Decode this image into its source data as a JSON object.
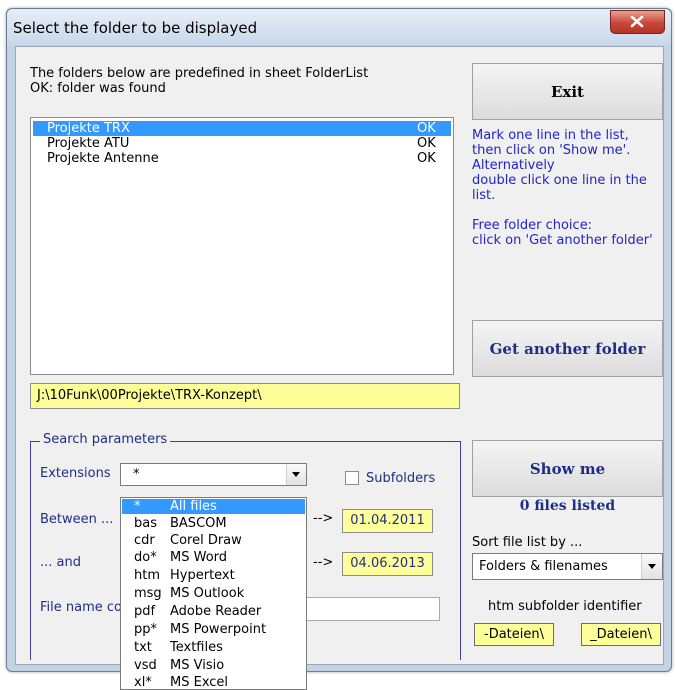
{
  "window": {
    "title": "Select the folder to be displayed",
    "close_icon": "close-icon"
  },
  "info": {
    "line1": "The folders below are predefined in sheet FolderList",
    "line2": "OK: folder was found"
  },
  "folders": [
    {
      "name": "Projekte TRX",
      "status": "OK",
      "selected": true
    },
    {
      "name": "Projekte ATU",
      "status": "OK",
      "selected": false
    },
    {
      "name": "Projekte Antenne",
      "status": "OK",
      "selected": false
    }
  ],
  "buttons": {
    "exit": "Exit",
    "get_another": "Get another folder",
    "show_me": "Show me"
  },
  "help": {
    "l1": "Mark one line in the list,",
    "l2": "then click on 'Show me'.",
    "l3": "Alternatively",
    "l4": "double click one line in the",
    "l5": "list.",
    "l6": "Free folder choice:",
    "l7": "click on 'Get another folder'"
  },
  "path": "J:\\10Funk\\00Projekte\\TRX-Konzept\\",
  "search": {
    "legend": "Search parameters",
    "extensions_label": "Extensions",
    "extensions_value": "*",
    "subfolders_label": "Subfolders",
    "subfolders_checked": false,
    "between_label": "Between ...",
    "and_label": "... and",
    "arrow": "-->",
    "date_from": "01.04.2011",
    "date_to": "04.06.2013",
    "filename_label": "File name co"
  },
  "extension_options": [
    {
      "ext": "*",
      "desc": "All files",
      "selected": true
    },
    {
      "ext": "bas",
      "desc": "BASCOM"
    },
    {
      "ext": "cdr",
      "desc": "Corel Draw"
    },
    {
      "ext": "do*",
      "desc": "MS Word"
    },
    {
      "ext": "htm",
      "desc": "Hypertext"
    },
    {
      "ext": "msg",
      "desc": "MS Outlook"
    },
    {
      "ext": "pdf",
      "desc": "Adobe Reader"
    },
    {
      "ext": "pp*",
      "desc": "MS Powerpoint"
    },
    {
      "ext": "txt",
      "desc": "Textfiles"
    },
    {
      "ext": "vsd",
      "desc": "MS Visio"
    },
    {
      "ext": "xl*",
      "desc": "MS Excel"
    }
  ],
  "files_listed": "0 files listed",
  "sort": {
    "label": "Sort file list by ...",
    "value": "Folders & filenames"
  },
  "htm": {
    "label": "htm subfolder identifier",
    "tag1": "-Dateien\\",
    "tag2": "_Dateien\\"
  },
  "colors": {
    "selection": "#3399ff",
    "highlight_field": "#ffff99",
    "accent_text": "#1f2d86",
    "help_text": "#2323c8"
  }
}
